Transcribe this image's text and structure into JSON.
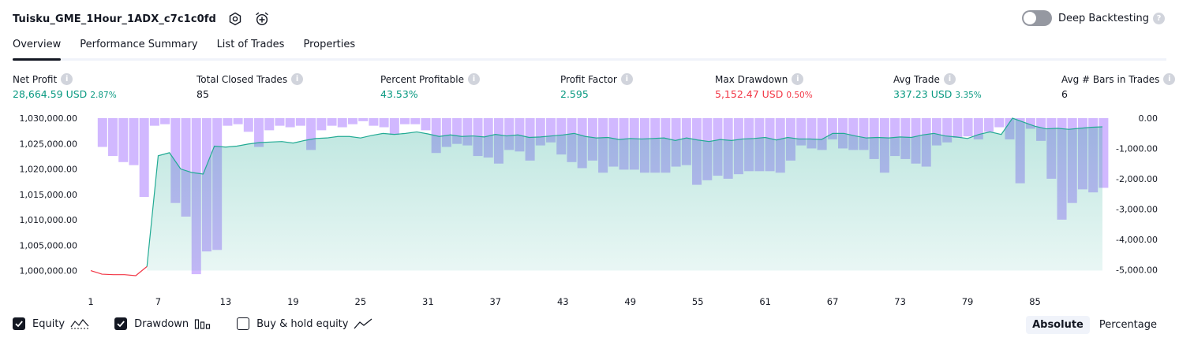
{
  "header": {
    "strategy_name": "Tuisku_GME_1Hour_1ADX_c7c1c0fd",
    "deep_backtesting_label": "Deep Backtesting",
    "help_glyph": "?"
  },
  "tabs": [
    {
      "label": "Overview",
      "active": true
    },
    {
      "label": "Performance Summary",
      "active": false
    },
    {
      "label": "List of Trades",
      "active": false
    },
    {
      "label": "Properties",
      "active": false
    }
  ],
  "metrics": [
    {
      "label": "Net Profit",
      "value": "28,664.59 USD",
      "pct": "2.87%",
      "color": "green"
    },
    {
      "label": "Total Closed Trades",
      "value": "85",
      "pct": "",
      "color": "dark"
    },
    {
      "label": "Percent Profitable",
      "value": "43.53%",
      "pct": "",
      "color": "green"
    },
    {
      "label": "Profit Factor",
      "value": "2.595",
      "pct": "",
      "color": "green"
    },
    {
      "label": "Max Drawdown",
      "value": "5,152.47 USD",
      "pct": "0.50%",
      "color": "red"
    },
    {
      "label": "Avg Trade",
      "value": "337.23 USD",
      "pct": "3.35%",
      "color": "green"
    },
    {
      "label": "Avg # Bars in Trades",
      "value": "6",
      "pct": "",
      "color": "dark"
    }
  ],
  "chart_data": {
    "type": "area",
    "x_ticks": [
      "1",
      "7",
      "13",
      "19",
      "25",
      "31",
      "37",
      "43",
      "49",
      "55",
      "61",
      "67",
      "73",
      "79",
      "85"
    ],
    "left_axis": {
      "ticks": [
        "1,030,000.00",
        "1,025,000.00",
        "1,020,000.00",
        "1,015,000.00",
        "1,010,000.00",
        "1,005,000.00",
        "1,000,000.00"
      ],
      "range": [
        999000,
        1030000
      ]
    },
    "right_axis": {
      "ticks": [
        "0.00",
        "-1,000.00",
        "-2,000.00",
        "-3,000.00",
        "-4,000.00",
        "-5,000.00"
      ],
      "range": [
        -5200,
        0
      ]
    },
    "colors": {
      "equity_up": "#22ab94",
      "equity_down": "#f23645",
      "equity_fill": "#22ab94",
      "drawdown_bar": "#b388ff"
    },
    "series": [
      {
        "name": "Equity",
        "values": [
          1000000,
          999300,
          999200,
          999200,
          999000,
          1000800,
          1022600,
          1023200,
          1020000,
          1019300,
          1019000,
          1024500,
          1024300,
          1024500,
          1024900,
          1025200,
          1025300,
          1025400,
          1025100,
          1025600,
          1026000,
          1026100,
          1026400,
          1026400,
          1026100,
          1026600,
          1027000,
          1026800,
          1027000,
          1027300,
          1026900,
          1026400,
          1026700,
          1026400,
          1026500,
          1026300,
          1026800,
          1026500,
          1026700,
          1026200,
          1026300,
          1026500,
          1026700,
          1027000,
          1026400,
          1026100,
          1026200,
          1025800,
          1026000,
          1025900,
          1026000,
          1026100,
          1025600,
          1026100,
          1025700,
          1025400,
          1025800,
          1025600,
          1025900,
          1026000,
          1026200,
          1025700,
          1026200,
          1025900,
          1025900,
          1025800,
          1027000,
          1027000,
          1026500,
          1026100,
          1026200,
          1026100,
          1026300,
          1026200,
          1026700,
          1027000,
          1026500,
          1026300,
          1026000,
          1026800,
          1027300,
          1026800,
          1030000,
          1029200,
          1028400,
          1027900,
          1028000,
          1027800,
          1028000,
          1028200,
          1028300
        ]
      },
      {
        "name": "Drawdown",
        "values": [
          0,
          -950,
          -1250,
          -1450,
          -1550,
          -2600,
          -250,
          -200,
          -2800,
          -3250,
          -5150,
          -4400,
          -4350,
          -250,
          -200,
          -450,
          -950,
          -400,
          -250,
          -300,
          -250,
          -1050,
          -400,
          -250,
          -300,
          -200,
          -100,
          -250,
          -300,
          -550,
          -200,
          -200,
          -400,
          -1150,
          -950,
          -850,
          -900,
          -1250,
          -1300,
          -1500,
          -1050,
          -1100,
          -1400,
          -900,
          -800,
          -1200,
          -1450,
          -1650,
          -1400,
          -1800,
          -1600,
          -1700,
          -1700,
          -1800,
          -1800,
          -1800,
          -1600,
          -1550,
          -2200,
          -2050,
          -1900,
          -2000,
          -1850,
          -1750,
          -1750,
          -1750,
          -1800,
          -1400,
          -900,
          -1000,
          -1050,
          -700,
          -1000,
          -1050,
          -1050,
          -1350,
          -1800,
          -1250,
          -1350,
          -1500,
          -1600,
          -900,
          -800,
          -650,
          -600,
          -700,
          -450,
          -300,
          -700,
          -2150,
          -350,
          -750,
          -2000,
          -3350,
          -2800,
          -2350,
          -2450,
          -2300
        ]
      }
    ]
  },
  "footer": {
    "legend": [
      {
        "label": "Equity",
        "checked": true
      },
      {
        "label": "Drawdown",
        "checked": true
      },
      {
        "label": "Buy & hold equity",
        "checked": false
      }
    ],
    "modes": [
      {
        "label": "Absolute",
        "active": true
      },
      {
        "label": "Percentage",
        "active": false
      }
    ]
  }
}
